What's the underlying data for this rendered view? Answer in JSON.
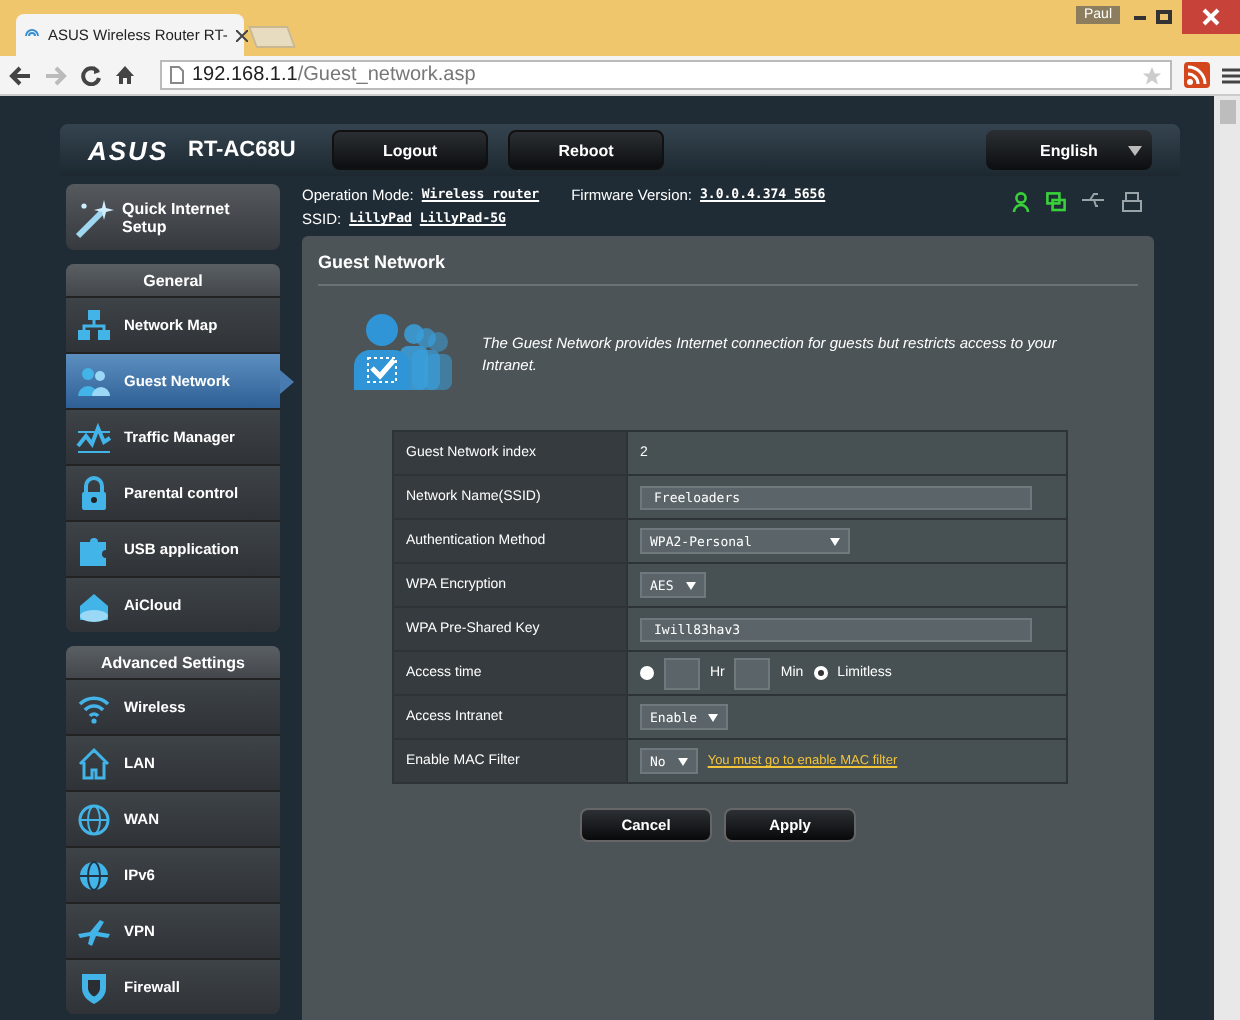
{
  "browser": {
    "tab_title": "ASUS Wireless Router RT-",
    "user": "Paul",
    "url_host": "192.168.1.1",
    "url_path": "/Guest_network.asp"
  },
  "header": {
    "logo": "ASUS",
    "model": "RT-AC68U",
    "buttons": [
      "Logout",
      "Reboot"
    ],
    "language": "English"
  },
  "status": {
    "mode_label": "Operation Mode:",
    "mode": "Wireless router",
    "firmware_label": "Firmware Version:",
    "firmware": "3.0.0.4.374_5656",
    "ssid_label": "SSID:",
    "ssids": [
      "LillyPad",
      "LillyPad-5G"
    ],
    "icons": [
      {
        "kind": "user",
        "on": true
      },
      {
        "kind": "screens",
        "on": true
      },
      {
        "kind": "usb",
        "on": false
      },
      {
        "kind": "printer",
        "on": false
      }
    ]
  },
  "sidebar": {
    "quick_setup": "Quick Internet Setup",
    "sections": [
      {
        "title": "General",
        "items": [
          {
            "label": "Network Map",
            "selected": false
          },
          {
            "label": "Guest Network",
            "selected": true
          },
          {
            "label": "Traffic Manager",
            "selected": false
          },
          {
            "label": "Parental control",
            "selected": false
          },
          {
            "label": "USB application",
            "selected": false
          },
          {
            "label": "AiCloud",
            "selected": false
          }
        ]
      },
      {
        "title": "Advanced Settings",
        "items": [
          {
            "label": "Wireless",
            "selected": false
          },
          {
            "label": "LAN",
            "selected": false
          },
          {
            "label": "WAN",
            "selected": false
          },
          {
            "label": "IPv6",
            "selected": false
          },
          {
            "label": "VPN",
            "selected": false
          },
          {
            "label": "Firewall",
            "selected": false
          }
        ]
      }
    ]
  },
  "main": {
    "title": "Guest Network",
    "description": "The Guest Network provides Internet connection for guests but restricts access to your Intranet.",
    "fields": [
      {
        "kind": "text",
        "label": "Guest Network index",
        "value": "2"
      },
      {
        "kind": "input",
        "label": "Network Name(SSID)",
        "value": "Freeloaders"
      },
      {
        "kind": "select",
        "label": "Authentication Method",
        "value": "WPA2-Personal"
      },
      {
        "kind": "select",
        "label": "WPA Encryption",
        "value": "AES"
      },
      {
        "kind": "input",
        "label": "WPA Pre-Shared Key",
        "value": "Iwill83hav3"
      },
      {
        "kind": "time",
        "label": "Access time",
        "hr": "Hr",
        "min": "Min",
        "radios": [
          {
            "selected": false
          },
          {
            "label": "Limitless",
            "selected": true
          }
        ]
      },
      {
        "kind": "select",
        "label": "Access Intranet",
        "value": "Enable"
      },
      {
        "kind": "select",
        "label": "Enable MAC Filter",
        "value": "No",
        "link": "You must go to enable MAC filter"
      }
    ],
    "buttons": [
      "Cancel",
      "Apply"
    ]
  }
}
